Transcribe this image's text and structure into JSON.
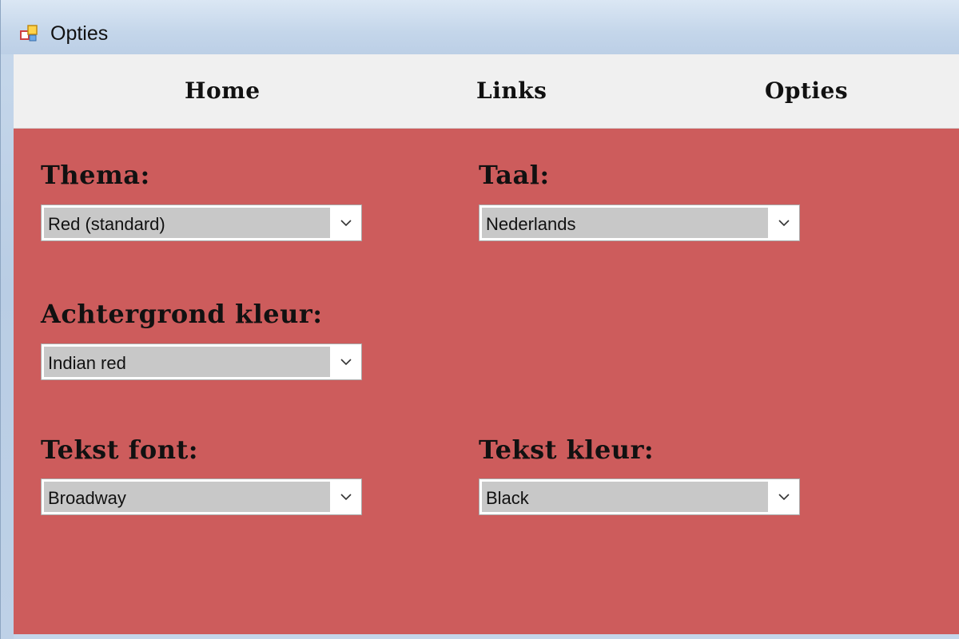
{
  "window": {
    "title": "Opties",
    "icon": "app-window-icon"
  },
  "menu": {
    "items": [
      {
        "label": "Home"
      },
      {
        "label": "Links"
      },
      {
        "label": "Opties"
      }
    ]
  },
  "settings": {
    "thema": {
      "label": "Thema:",
      "value": "Red (standard)"
    },
    "taal": {
      "label": "Taal:",
      "value": "Nederlands"
    },
    "achtergrond": {
      "label": "Achtergrond kleur:",
      "value": "Indian red"
    },
    "font": {
      "label": "Tekst font:",
      "value": "Broadway"
    },
    "tekstkleur": {
      "label": "Tekst kleur:",
      "value": "Black"
    }
  },
  "colors": {
    "background": "#cd5c5c",
    "menubar": "#f0f0f0",
    "combo_field": "#c8c8c8",
    "text": "#111111"
  }
}
